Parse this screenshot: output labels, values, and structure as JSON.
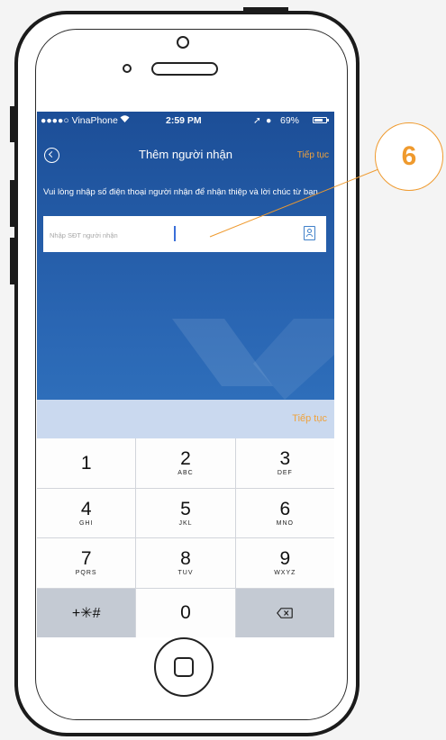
{
  "status_bar": {
    "carrier": "●●●●○ VinaPhone",
    "wifi_icon": "wifi-icon",
    "time": "2:59 PM",
    "battery_percent": "69%"
  },
  "nav": {
    "back_icon": "circle-back-icon",
    "title": "Thêm người nhận",
    "next_label": "Tiếp tục"
  },
  "instruction": "Vui lòng nhập số điện thoại người nhận để nhận thiệp và lời chúc từ bạn",
  "phone_input": {
    "placeholder": "Nhập SĐT người nhận",
    "value": "",
    "contact_icon": "contacts-book-icon"
  },
  "keyboard": {
    "toolbar_next_label": "Tiếp tục",
    "keys": [
      {
        "num": "1",
        "letters": ""
      },
      {
        "num": "2",
        "letters": "ABC"
      },
      {
        "num": "3",
        "letters": "DEF"
      },
      {
        "num": "4",
        "letters": "GHI"
      },
      {
        "num": "5",
        "letters": "JKL"
      },
      {
        "num": "6",
        "letters": "MNO"
      },
      {
        "num": "7",
        "letters": "PQRS"
      },
      {
        "num": "8",
        "letters": "TUV"
      },
      {
        "num": "9",
        "letters": "WXYZ"
      },
      {
        "num": "0",
        "letters": ""
      }
    ],
    "symbols_label": "+✳#",
    "delete_icon": "backspace-icon"
  },
  "callout": {
    "number": "6",
    "color": "#ef9a2e"
  },
  "colors": {
    "nav_bg": "#1c4e97",
    "accent_orange": "#f0a23b",
    "keyboard_bar": "#cad9ef"
  }
}
